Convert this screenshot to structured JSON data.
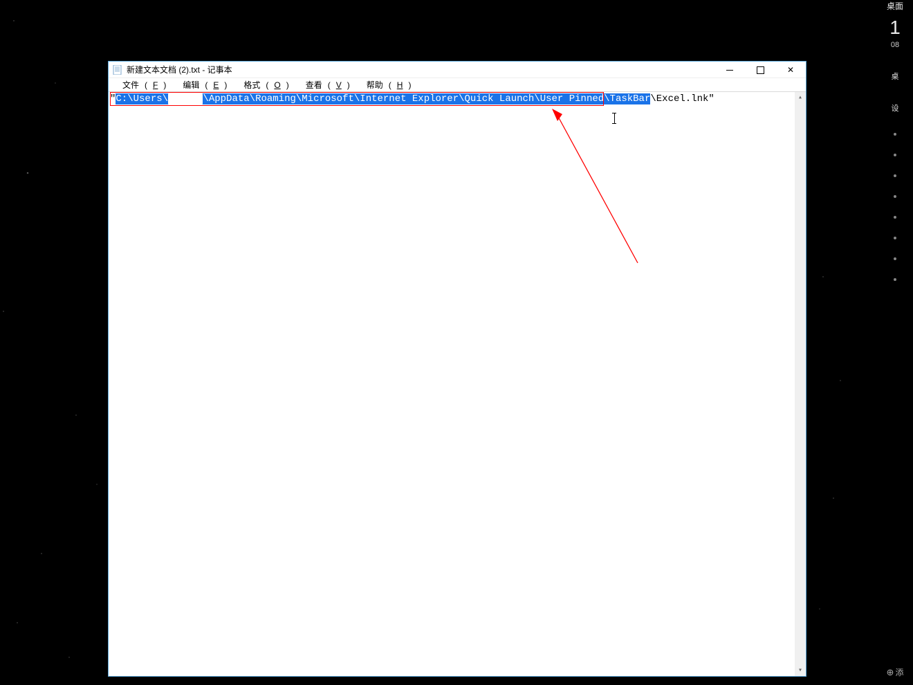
{
  "sidebar": {
    "top_label": "桌面",
    "clock": "1",
    "date": "08",
    "row1": "桌",
    "row2": "设",
    "add_label": "添"
  },
  "window": {
    "title": "新建文本文档 (2).txt - 记事本",
    "menu": {
      "file": {
        "label": "文件",
        "acc": "F"
      },
      "edit": {
        "label": "编辑",
        "acc": "E"
      },
      "format": {
        "label": "格式",
        "acc": "O"
      },
      "view": {
        "label": "查看",
        "acc": "V"
      },
      "help": {
        "label": "帮助",
        "acc": "H"
      }
    },
    "content": {
      "lead_quote": "\"",
      "path_prefix": "C:\\Users\\",
      "username_redacted": "██████",
      "path_middle": "\\AppData\\Roaming\\Microsoft\\Internet Explorer\\Quick Launch\\User Pinned\\TaskBar",
      "path_tail": "\\Excel.lnk\""
    }
  }
}
